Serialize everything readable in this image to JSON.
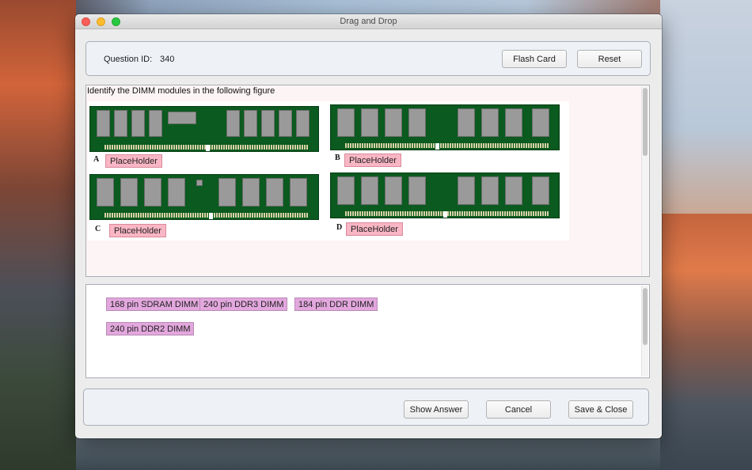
{
  "window": {
    "title": "Drag and Drop"
  },
  "header": {
    "question_id_label": "Question ID:",
    "question_id_value": "340",
    "flash_card_label": "Flash Card",
    "reset_label": "Reset"
  },
  "question": {
    "text": "Identify the DIMM modules in the following figure",
    "figure_letters": [
      "A",
      "B",
      "C",
      "D"
    ],
    "drop_zones": [
      "PlaceHolder",
      "PlaceHolder",
      "PlaceHolder",
      "PlaceHolder"
    ]
  },
  "answers": {
    "tiles": [
      "168 pin SDRAM DIMM",
      "240 pin DDR3 DIMM",
      "184 pin DDR DIMM",
      "240 pin DDR2 DIMM"
    ]
  },
  "footer": {
    "show_answer_label": "Show Answer",
    "cancel_label": "Cancel",
    "save_close_label": "Save & Close"
  },
  "colors": {
    "drop_zone": "#f9b6c4",
    "answer_tile": "#e2a7dd",
    "pcb_green": "#0b5a1f"
  }
}
